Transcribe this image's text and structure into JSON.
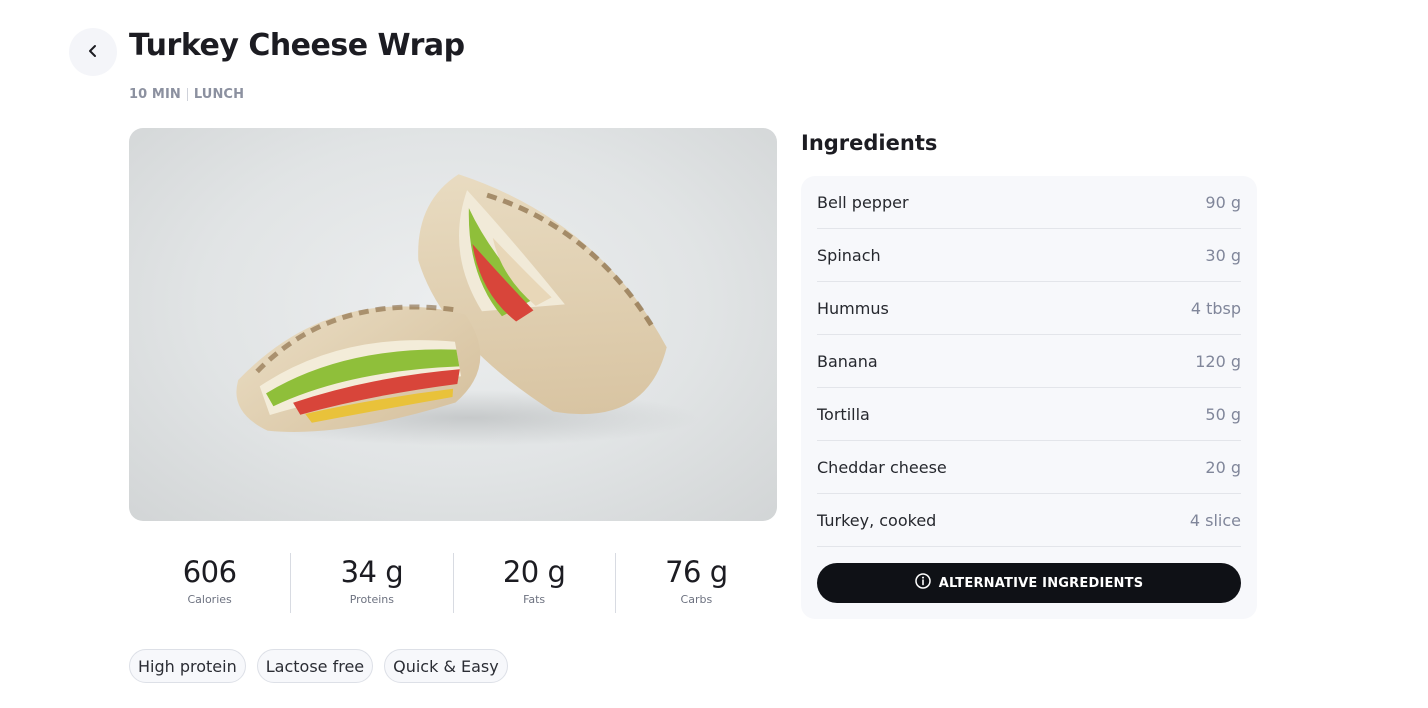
{
  "header": {
    "title": "Turkey Cheese Wrap",
    "time": "10 MIN",
    "meal": "LUNCH"
  },
  "stats": [
    {
      "value": "606",
      "label": "Calories"
    },
    {
      "value": "34 g",
      "label": "Proteins"
    },
    {
      "value": "20 g",
      "label": "Fats"
    },
    {
      "value": "76 g",
      "label": "Carbs"
    }
  ],
  "tags": [
    "High protein",
    "Lactose free",
    "Quick & Easy"
  ],
  "ingredients": {
    "heading": "Ingredients",
    "items": [
      {
        "name": "Bell pepper",
        "qty": "90 g"
      },
      {
        "name": "Spinach",
        "qty": "30 g"
      },
      {
        "name": "Hummus",
        "qty": "4 tbsp"
      },
      {
        "name": "Banana",
        "qty": "120 g"
      },
      {
        "name": "Tortilla",
        "qty": "50 g"
      },
      {
        "name": "Cheddar cheese",
        "qty": "20 g"
      },
      {
        "name": "Turkey, cooked",
        "qty": "4 slice"
      }
    ],
    "alternative_button": "ALTERNATIVE INGREDIENTS"
  },
  "icons": {
    "back": "chevron-left-icon",
    "info": "info-circle-icon"
  },
  "colors": {
    "button_bg": "#0f1116",
    "card_bg": "#f7f8fb",
    "muted_text": "#8c91a0"
  }
}
